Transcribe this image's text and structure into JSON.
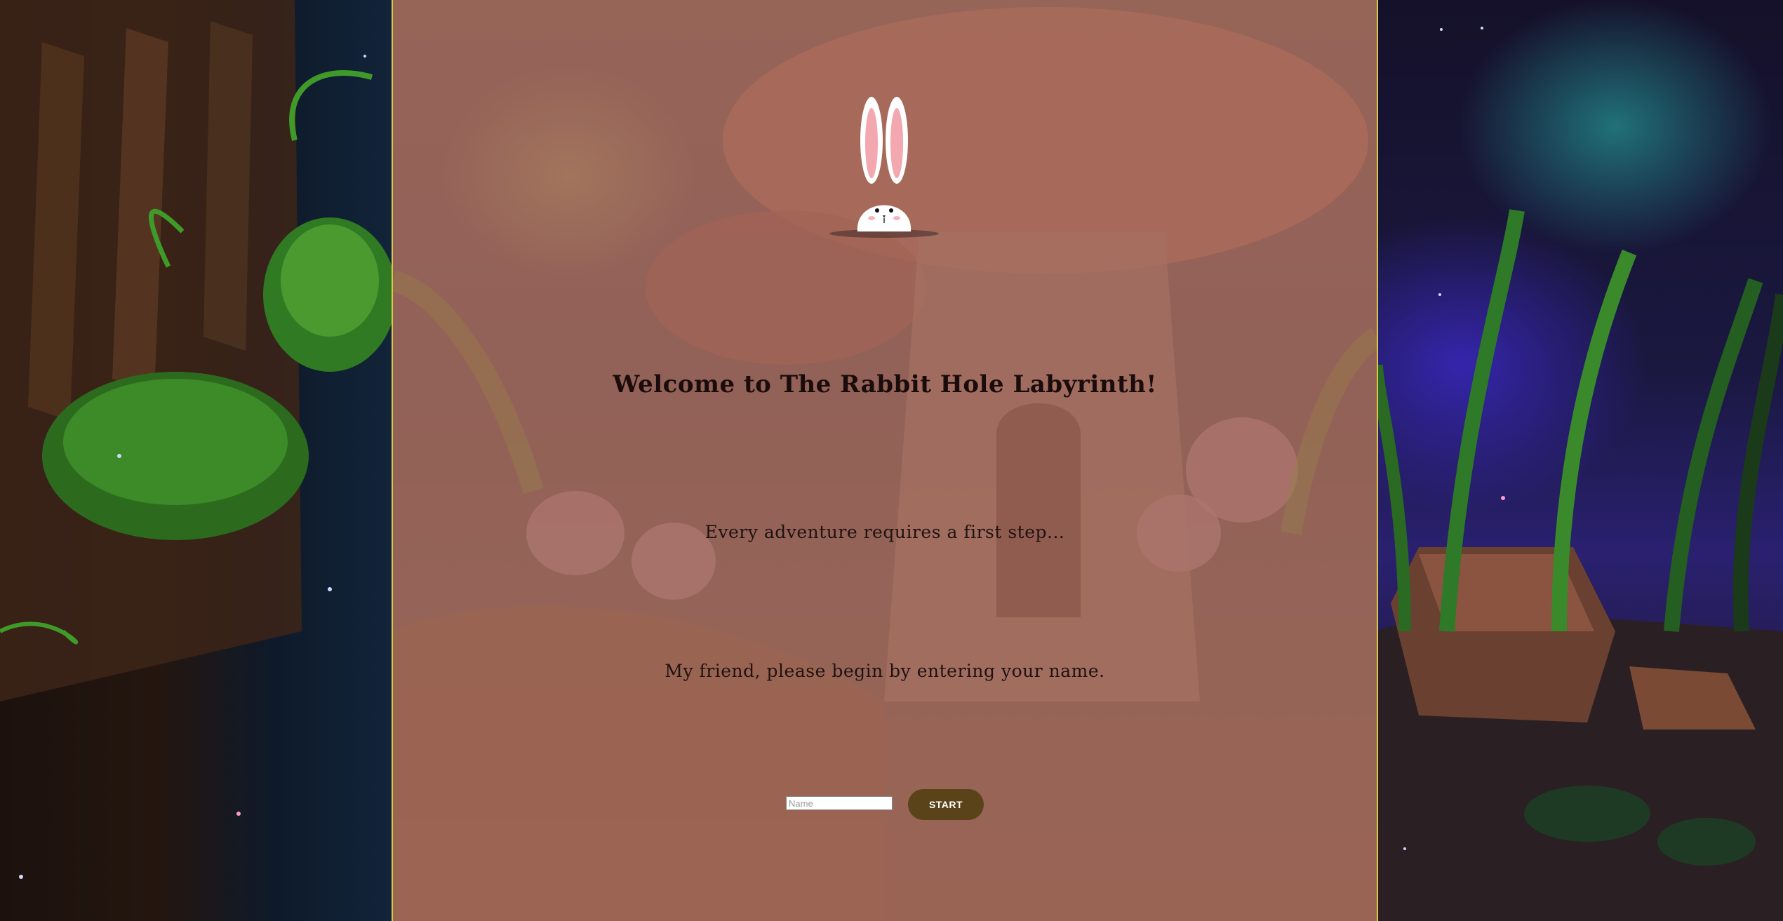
{
  "page": {
    "title": "Welcome to The Rabbit Hole Labyrinth!",
    "subtitle": "Every adventure requires a first step...",
    "prompt": "My friend, please begin by entering your name."
  },
  "form": {
    "name_placeholder": "Name",
    "name_value": "",
    "start_label": "START"
  },
  "colors": {
    "panel_border": "#d8c94a",
    "button_bg": "#5a4318",
    "button_text": "#ffffff",
    "heading_text": "#1a0c0a"
  },
  "icons": {
    "rabbit": "rabbit-peeking-icon"
  }
}
